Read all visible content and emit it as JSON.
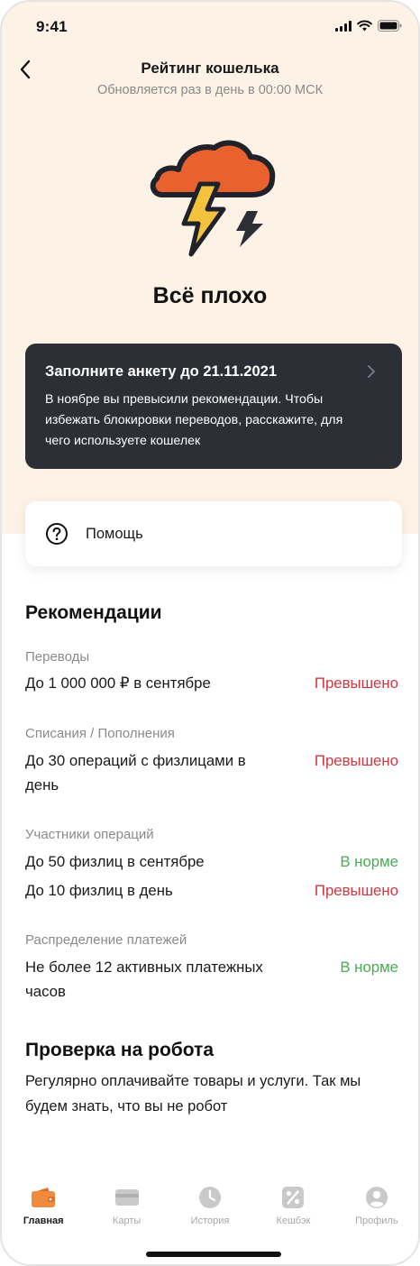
{
  "status_bar": {
    "time": "9:41"
  },
  "header": {
    "title": "Рейтинг кошелька",
    "subtitle": "Обновляется раз в день в 00:00 МСК"
  },
  "hero": {
    "status": "Всё плохо",
    "icon": "storm-cloud-lightning-icon"
  },
  "banner": {
    "title": "Заполните анкету до 21.11.2021",
    "text": "В ноябре вы превысили рекомендации. Чтобы избежать блокировки переводов, расскажите, для чего используете кошелек"
  },
  "help": {
    "label": "Помощь"
  },
  "recommendations": {
    "title": "Рекомендации",
    "groups": [
      {
        "label": "Переводы",
        "items": [
          {
            "text": "До 1 000 000 ₽ в сентябре",
            "status": "Превышено"
          }
        ]
      },
      {
        "label": "Списания / Пополнения",
        "items": [
          {
            "text": "До 30 операций с физлицами в день",
            "status": "Превышено"
          }
        ]
      },
      {
        "label": "Участники операций",
        "items": [
          {
            "text": "До 50 физлиц в сентябре",
            "status": "В норме"
          },
          {
            "text": "До 10 физлиц в день",
            "status": "Превышено"
          }
        ]
      },
      {
        "label": "Распределение платежей",
        "items": [
          {
            "text": "Не более 12 активных платежных часов",
            "status": "В норме"
          }
        ]
      }
    ]
  },
  "robot": {
    "title": "Проверка на робота",
    "text": "Регулярно оплачивайте товары и услуги. Так мы будем знать, что вы не робот"
  },
  "tabbar": {
    "active": "Главная",
    "tabs": [
      {
        "label": "Главная",
        "icon": "wallet-icon"
      },
      {
        "label": "Карты",
        "icon": "card-icon"
      },
      {
        "label": "История",
        "icon": "clock-icon"
      },
      {
        "label": "Кешбэк",
        "icon": "percent-icon"
      },
      {
        "label": "Профиль",
        "icon": "profile-icon"
      }
    ]
  },
  "colors": {
    "accent": "#f08a3c",
    "hero_background": "#fcf2e6",
    "banner_background": "#2c2f36",
    "exceeded": "#d0373f",
    "normal": "#4caa56"
  }
}
